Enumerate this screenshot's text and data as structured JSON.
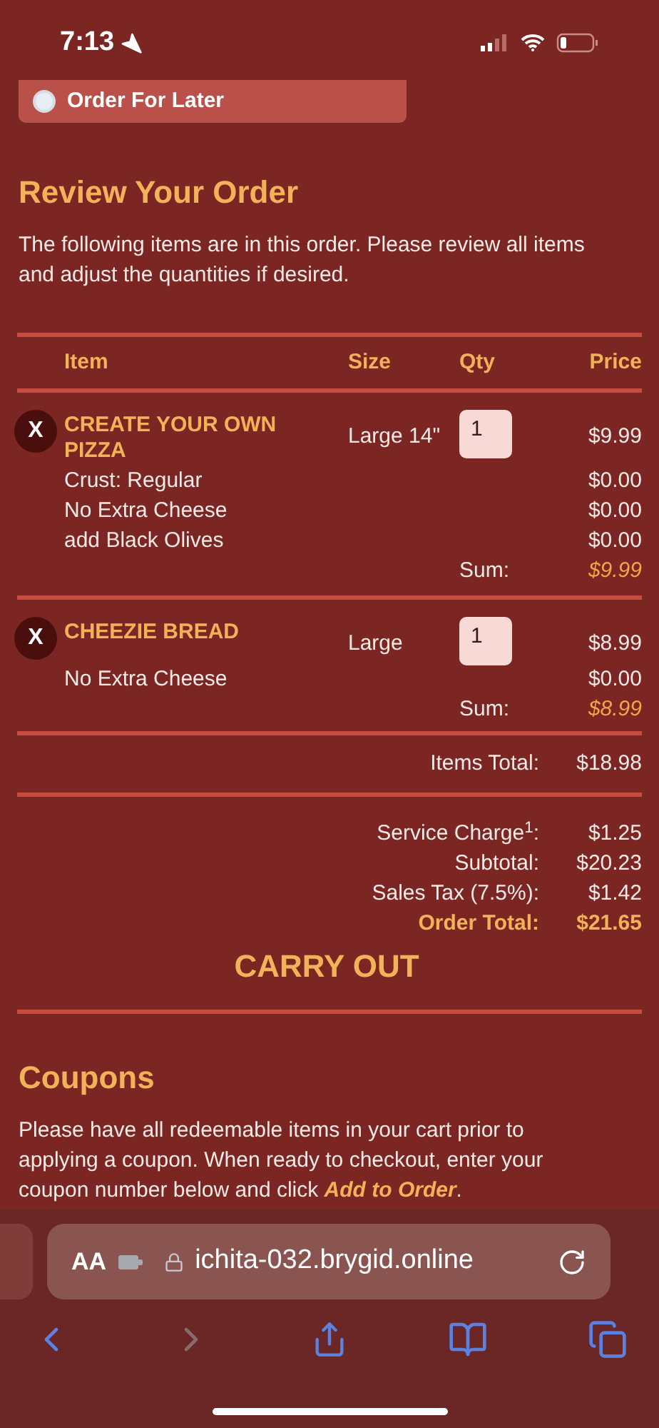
{
  "status_bar": {
    "time": "7:13"
  },
  "order_option": {
    "label": "Order For Later",
    "selected": false
  },
  "review": {
    "title": "Review Your Order",
    "description": "The following items are in this order. Please review all items and adjust the quantities if desired."
  },
  "table": {
    "columns": [
      "Item",
      "Size",
      "Qty",
      "Price"
    ],
    "items": [
      {
        "remove": "X",
        "name": "CREATE YOUR OWN PIZZA",
        "size": "Large 14\"",
        "qty": "1",
        "price": "$9.99",
        "options": [
          {
            "label": "Crust: Regular",
            "price": "$0.00"
          },
          {
            "label": "No Extra Cheese",
            "price": "$0.00"
          },
          {
            "label": "add Black Olives",
            "price": "$0.00"
          }
        ],
        "sum_label": "Sum:",
        "sum": "$9.99"
      },
      {
        "remove": "X",
        "name": "CHEEZIE BREAD",
        "size": "Large",
        "qty": "1",
        "price": "$8.99",
        "options": [
          {
            "label": "No Extra Cheese",
            "price": "$0.00"
          }
        ],
        "sum_label": "Sum:",
        "sum": "$8.99"
      }
    ]
  },
  "items_total": {
    "label": "Items Total:",
    "value": "$18.98"
  },
  "charges": [
    {
      "label": "Service Charge$^{1}$:",
      "value": "$1.25",
      "kind": "normal"
    },
    {
      "label": "Subtotal:",
      "value": "$20.23",
      "kind": "normal"
    },
    {
      "label": "Sales Tax (7.5%):",
      "value": "$1.42",
      "kind": "normal"
    },
    {
      "label": "Order Total:",
      "value": "$21.65",
      "kind": "total"
    }
  ],
  "order_type": "CARRY OUT",
  "coupons": {
    "title": "Coupons",
    "text_before": "Please have all redeemable items in your cart prior to applying a coupon. When ready to checkout, enter your coupon number below and click ",
    "link": "Add to Order",
    "text_after": "."
  },
  "browser": {
    "text_size": "AA",
    "url": "ichita-032.brygid.online",
    "back_disabled": false,
    "forward_disabled": true
  }
}
